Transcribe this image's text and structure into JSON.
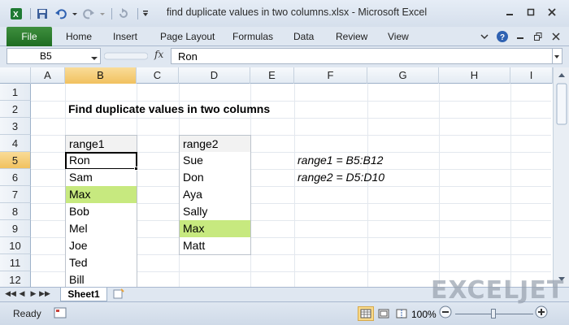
{
  "window": {
    "title": "find duplicate values in two columns.xlsx  -  Microsoft Excel"
  },
  "ribbon": {
    "file_label": "File",
    "tabs": [
      "Home",
      "Insert",
      "Page Layout",
      "Formulas",
      "Data",
      "Review",
      "View"
    ]
  },
  "formula_bar": {
    "name_box": "B5",
    "fx_label": "fx",
    "formula": "Ron"
  },
  "columns": [
    "A",
    "B",
    "C",
    "D",
    "E",
    "F",
    "G",
    "H",
    "I"
  ],
  "active_column": "B",
  "rows": [
    "1",
    "2",
    "3",
    "4",
    "5",
    "6",
    "7",
    "8",
    "9",
    "10",
    "11",
    "12"
  ],
  "active_row": "5",
  "sheet": {
    "title": "Find duplicate values in two columns",
    "range1": {
      "header": "range1",
      "values": [
        "Ron",
        "Sam",
        "Max",
        "Bob",
        "Mel",
        "Joe",
        "Ted",
        "Bill"
      ],
      "highlighted": [
        "Max"
      ]
    },
    "range2": {
      "header": "range2",
      "values": [
        "Sue",
        "Don",
        "Aya",
        "Sally",
        "Max",
        "Matt"
      ],
      "highlighted": [
        "Max"
      ]
    },
    "notes": [
      "range1 = B5:B12",
      "range2 = D5:D10"
    ],
    "highlight_color": "#c7e97f"
  },
  "sheet_tabs": {
    "active": "Sheet1"
  },
  "status": {
    "ready": "Ready",
    "zoom": "100%"
  },
  "logo": "EXCELJET"
}
